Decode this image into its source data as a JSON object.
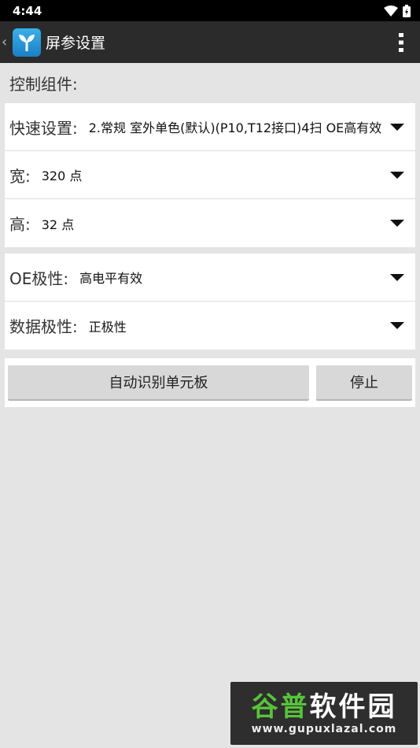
{
  "status_bar": {
    "time": "4:44"
  },
  "app_bar": {
    "title": "屏参设置"
  },
  "section": {
    "label": "控制组件:"
  },
  "settings_group_1": [
    {
      "label": "快速设置:",
      "value": "2.常规 室外单色(默认)(P10,T12接口)4扫 OE高有效"
    },
    {
      "label": "宽:",
      "value": "320 点"
    },
    {
      "label": "高:",
      "value": "32 点"
    }
  ],
  "settings_group_2": [
    {
      "label": "OE极性:",
      "value": "高电平有效"
    },
    {
      "label": "数据极性:",
      "value": "正极性"
    }
  ],
  "buttons": {
    "auto_detect": "自动识别单元板",
    "stop": "停止"
  },
  "watermark": {
    "name_part1": "谷普",
    "name_part2": "软件园",
    "url": "www.gupuxlazal.com"
  },
  "colors": {
    "app_bar": "#2b2b2b",
    "status_bar": "#000000",
    "background": "#e4e4e4",
    "card": "#ffffff",
    "button": "#d8d8d8",
    "watermark_green": "#58c43b"
  }
}
